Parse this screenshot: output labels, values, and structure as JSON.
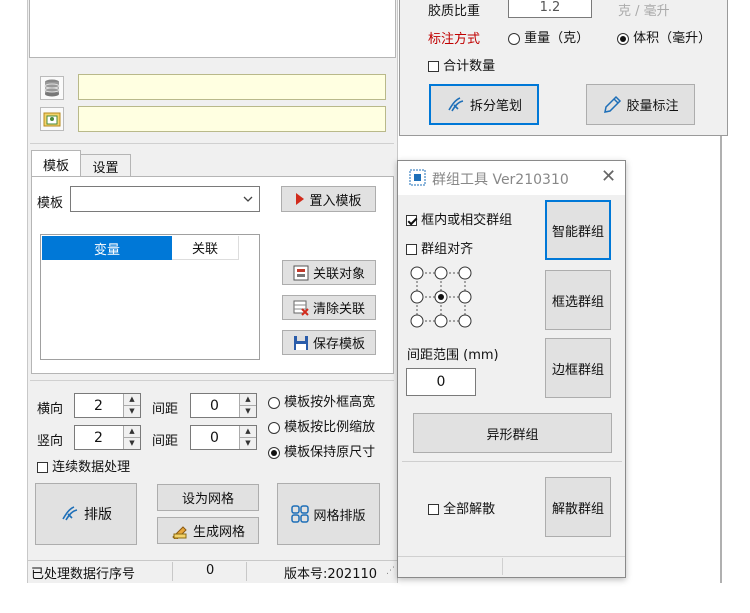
{
  "main": {
    "tabs": [
      {
        "label": "模板"
      },
      {
        "label": "设置"
      }
    ],
    "template_label": "模板",
    "template_value": "",
    "import_template_label": "置入模板",
    "table_headers": [
      "变量",
      "关联"
    ],
    "associate_label": "关联对象",
    "clear_association_label": "清除关联",
    "save_template_label": "保存模板",
    "horizontal_label": "横向",
    "horizontal_value": "2",
    "vertical_label": "竖向",
    "vertical_value": "2",
    "spacing_label": "间距",
    "h_spacing_value": "0",
    "v_spacing_value": "0",
    "radio_options": [
      "模板按外框高宽",
      "模板按比例缩放",
      "模板保持原尺寸"
    ],
    "selected_radio": "模板保持原尺寸",
    "continuous_label": "连续数据处理",
    "layout_button_label": "排版",
    "set_grid_label": "设为网格",
    "generate_grid_label": "生成网格",
    "grid_layout_label": "网格排版"
  },
  "status_bar": {
    "processed_label": "已处理数据行序号",
    "processed_value": "0",
    "version_label": "版本号:202110"
  },
  "top_panel": {
    "density_label": "胶质比重",
    "density_value": "1.2",
    "unit_label": "克 / 毫升",
    "annotation_label": "标注方式",
    "weight_option": "重量（克）",
    "volume_option": "体积（毫升）",
    "selected_option": "体积（毫升）",
    "total_count_label": "合计数量",
    "split_stroke_label": "拆分笔划",
    "glue_annotation_label": "胶量标注"
  },
  "group_tool": {
    "title": "群组工具 Ver210310",
    "inside_or_intersect_label": "框内或相交群组",
    "align_label": "群组对齐",
    "smart_group_label": "智能群组",
    "box_select_group_label": "框选群组",
    "border_group_label": "边框群组",
    "spacing_range_label": "间距范围 (mm)",
    "spacing_range_value": "0",
    "irregular_group_label": "异形群组",
    "dissolve_all_label": "全部解散",
    "dissolve_group_label": "解散群组"
  },
  "colors": {
    "accent": "#0078d7",
    "header_blue": "#0078d7",
    "yellow_field": "#ffffe1",
    "red_text": "#c00000"
  }
}
